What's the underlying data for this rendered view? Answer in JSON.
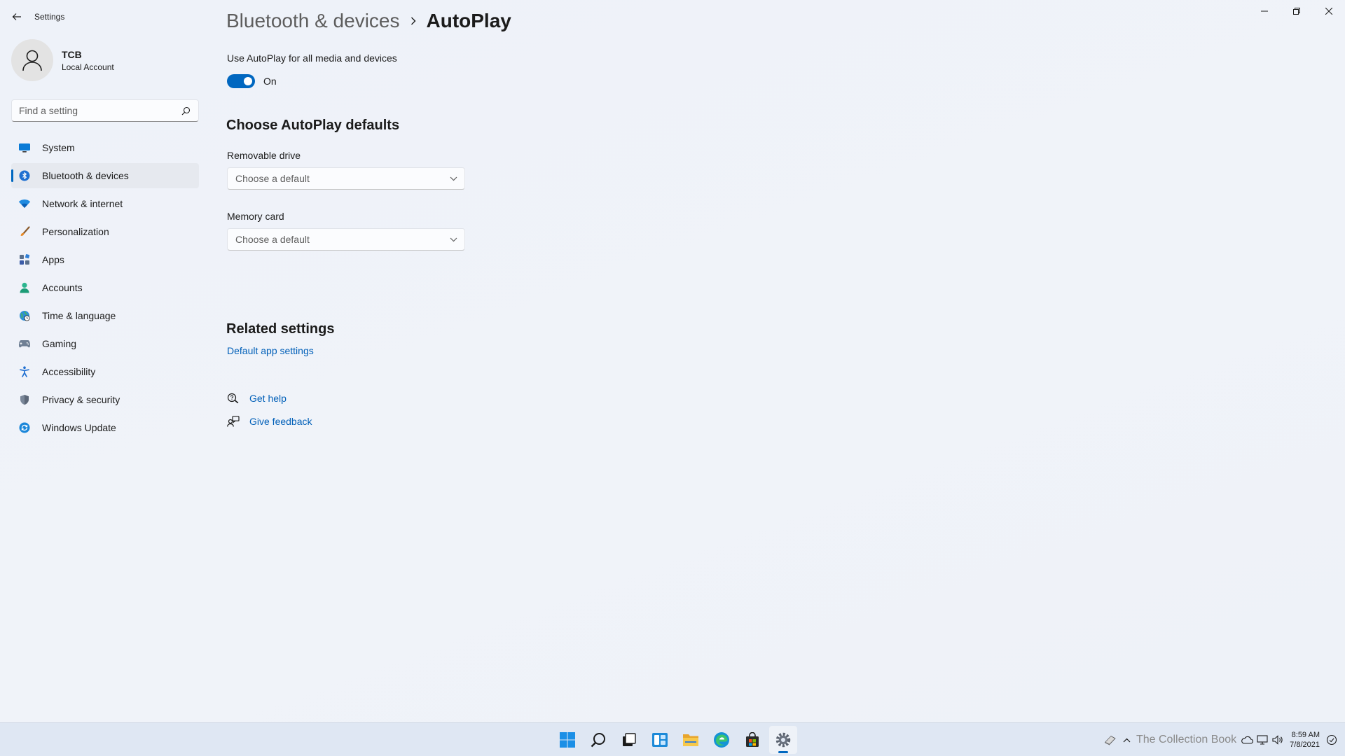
{
  "app": {
    "title": "Settings"
  },
  "window_controls": {
    "minimize": "minimize-icon",
    "maximize": "restore-icon",
    "close": "close-icon"
  },
  "profile": {
    "name": "TCB",
    "account_type": "Local Account"
  },
  "search": {
    "placeholder": "Find a setting",
    "value": ""
  },
  "sidebar": {
    "active_index": 1,
    "items": [
      {
        "label": "System",
        "icon": "monitor-icon"
      },
      {
        "label": "Bluetooth & devices",
        "icon": "bluetooth-icon"
      },
      {
        "label": "Network & internet",
        "icon": "wifi-icon"
      },
      {
        "label": "Personalization",
        "icon": "brush-icon"
      },
      {
        "label": "Apps",
        "icon": "apps-icon"
      },
      {
        "label": "Accounts",
        "icon": "person-icon"
      },
      {
        "label": "Time & language",
        "icon": "globe-clock-icon"
      },
      {
        "label": "Gaming",
        "icon": "gamepad-icon"
      },
      {
        "label": "Accessibility",
        "icon": "accessibility-icon"
      },
      {
        "label": "Privacy & security",
        "icon": "shield-icon"
      },
      {
        "label": "Windows Update",
        "icon": "update-icon"
      }
    ]
  },
  "breadcrumb": {
    "parent": "Bluetooth & devices",
    "current": "AutoPlay"
  },
  "autoplay": {
    "toggle_label": "Use AutoPlay for all media and devices",
    "toggle_state": "On",
    "toggle_on": true
  },
  "defaults": {
    "title": "Choose AutoPlay defaults",
    "removable_drive": {
      "label": "Removable drive",
      "value": "Choose a default"
    },
    "memory_card": {
      "label": "Memory card",
      "value": "Choose a default"
    }
  },
  "related": {
    "title": "Related settings",
    "default_apps_link": "Default app settings"
  },
  "help": {
    "get_help": "Get help",
    "give_feedback": "Give feedback"
  },
  "taskbar": {
    "apps": [
      "start-icon",
      "search-icon",
      "task-view-icon",
      "widgets-icon",
      "file-explorer-icon",
      "edge-icon",
      "store-icon",
      "settings-icon"
    ],
    "active_app": "settings-icon",
    "watermark": "The Collection Book",
    "time": "8:59 AM",
    "date": "7/8/2021"
  },
  "colors": {
    "accent": "#0067c0",
    "link": "#005fb8",
    "background": "#eef2f8"
  }
}
